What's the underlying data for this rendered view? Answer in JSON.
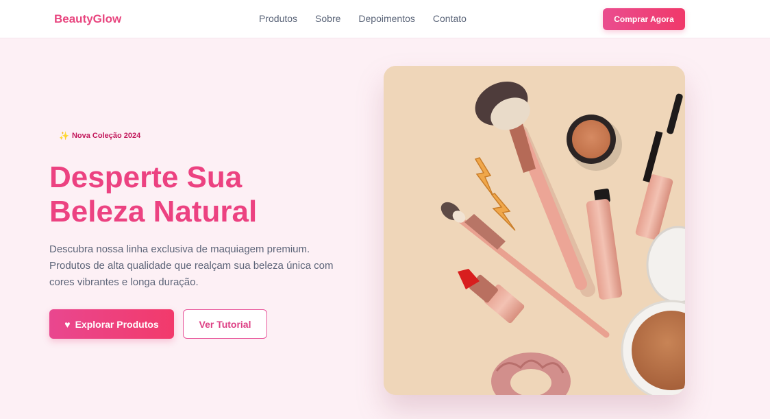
{
  "header": {
    "brand": "BeautyGlow",
    "nav": [
      "Produtos",
      "Sobre",
      "Depoimentos",
      "Contato"
    ],
    "cta": "Comprar Agora"
  },
  "hero": {
    "badge_icon": "sparkle-icon",
    "badge": "Nova Coleção 2024",
    "title_line1": "Desperte Sua",
    "title_line2": "Beleza Natural",
    "description_lines": [
      "Descubra nossa linha exclusiva de maquiagem premium.",
      "Produtos de alta qualidade que realçam sua beleza única com",
      "cores vibrantes e longa duração."
    ],
    "primary_button": "Explorar Produtos",
    "primary_button_icon": "heart-icon",
    "secondary_button": "Ver Tutorial",
    "image_subject": "makeup-products-flatlay"
  },
  "colors": {
    "brand": "#e8467f",
    "page_background": "#fdf0f5",
    "image_background": "#efd6b9",
    "body_text": "#5c6478"
  }
}
